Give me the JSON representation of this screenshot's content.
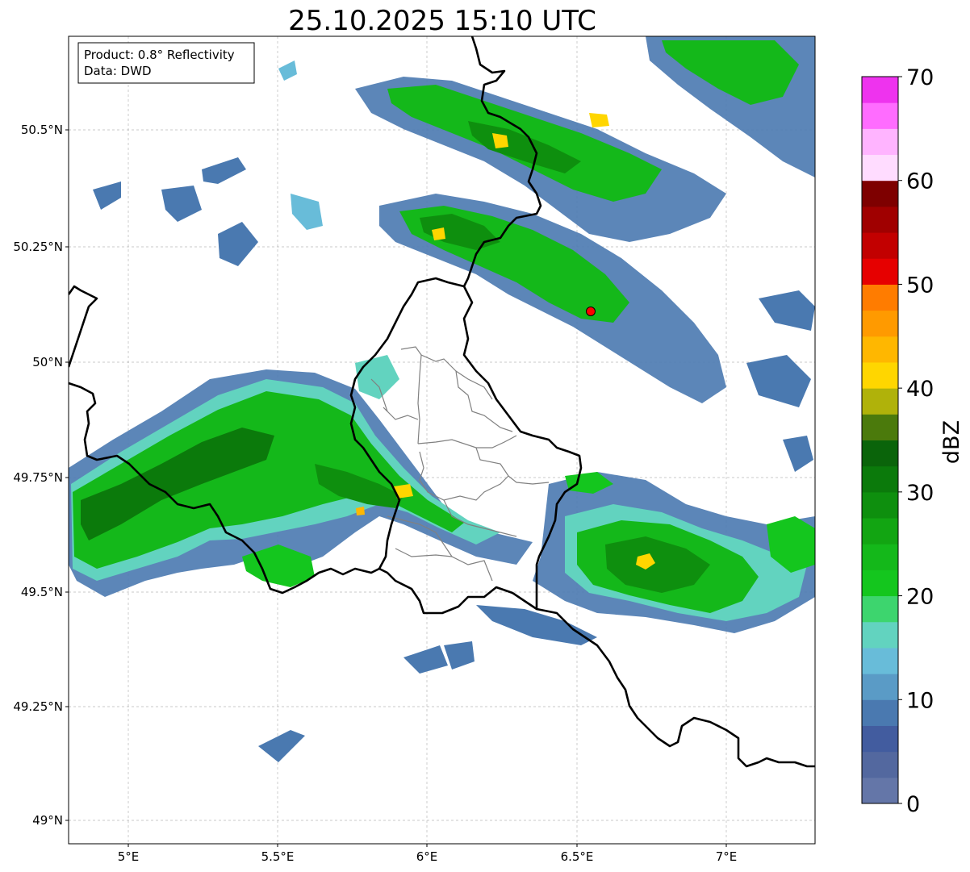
{
  "title": "25.10.2025 15:10 UTC",
  "info_box": {
    "product": "Product: 0.8° Reflectivity",
    "data": "Data: DWD"
  },
  "map": {
    "type": "radar-reflectivity-map",
    "extent": {
      "lon": [
        4.8,
        7.3
      ],
      "lat": [
        48.95,
        50.7
      ]
    },
    "x_ticks": [
      {
        "value": 5.0,
        "label": "5°E"
      },
      {
        "value": 5.5,
        "label": "5.5°E"
      },
      {
        "value": 6.0,
        "label": "6°E"
      },
      {
        "value": 6.5,
        "label": "6.5°E"
      },
      {
        "value": 7.0,
        "label": "7°E"
      }
    ],
    "y_ticks": [
      {
        "value": 49.0,
        "label": "49°N"
      },
      {
        "value": 49.25,
        "label": "49.25°N"
      },
      {
        "value": 49.5,
        "label": "49.5°N"
      },
      {
        "value": 49.75,
        "label": "49.75°N"
      },
      {
        "value": 50.0,
        "label": "50°N"
      },
      {
        "value": 50.25,
        "label": "50.25°N"
      },
      {
        "value": 50.5,
        "label": "50.5°N"
      }
    ],
    "grid": true,
    "radar_site": {
      "lon": 6.55,
      "lat": 50.11,
      "color": "#ff0000"
    },
    "colorbar": {
      "label": "dBZ",
      "min": 0,
      "max": 70,
      "step": 2.5,
      "tick_values": [
        0,
        10,
        20,
        30,
        40,
        50,
        60,
        70
      ],
      "tick_labels": [
        "0",
        "10",
        "20",
        "30",
        "40",
        "50",
        "60",
        "70"
      ],
      "colors": [
        "#6476a8",
        "#53689f",
        "#425c9f",
        "#4a79b0",
        "#5a9bc6",
        "#68bcd9",
        "#62d3bf",
        "#3dd56e",
        "#14c61e",
        "#14b81a",
        "#12a512",
        "#0e8f0e",
        "#0b7a0b",
        "#0a640a",
        "#4b7a0c",
        "#b0b20a",
        "#ffd600",
        "#ffb700",
        "#ff9a00",
        "#ff7c00",
        "#e60000",
        "#c20000",
        "#a00000",
        "#7e0000",
        "#ffdcff",
        "#ffb4ff",
        "#ff6cff",
        "#ee33ee"
      ]
    }
  }
}
